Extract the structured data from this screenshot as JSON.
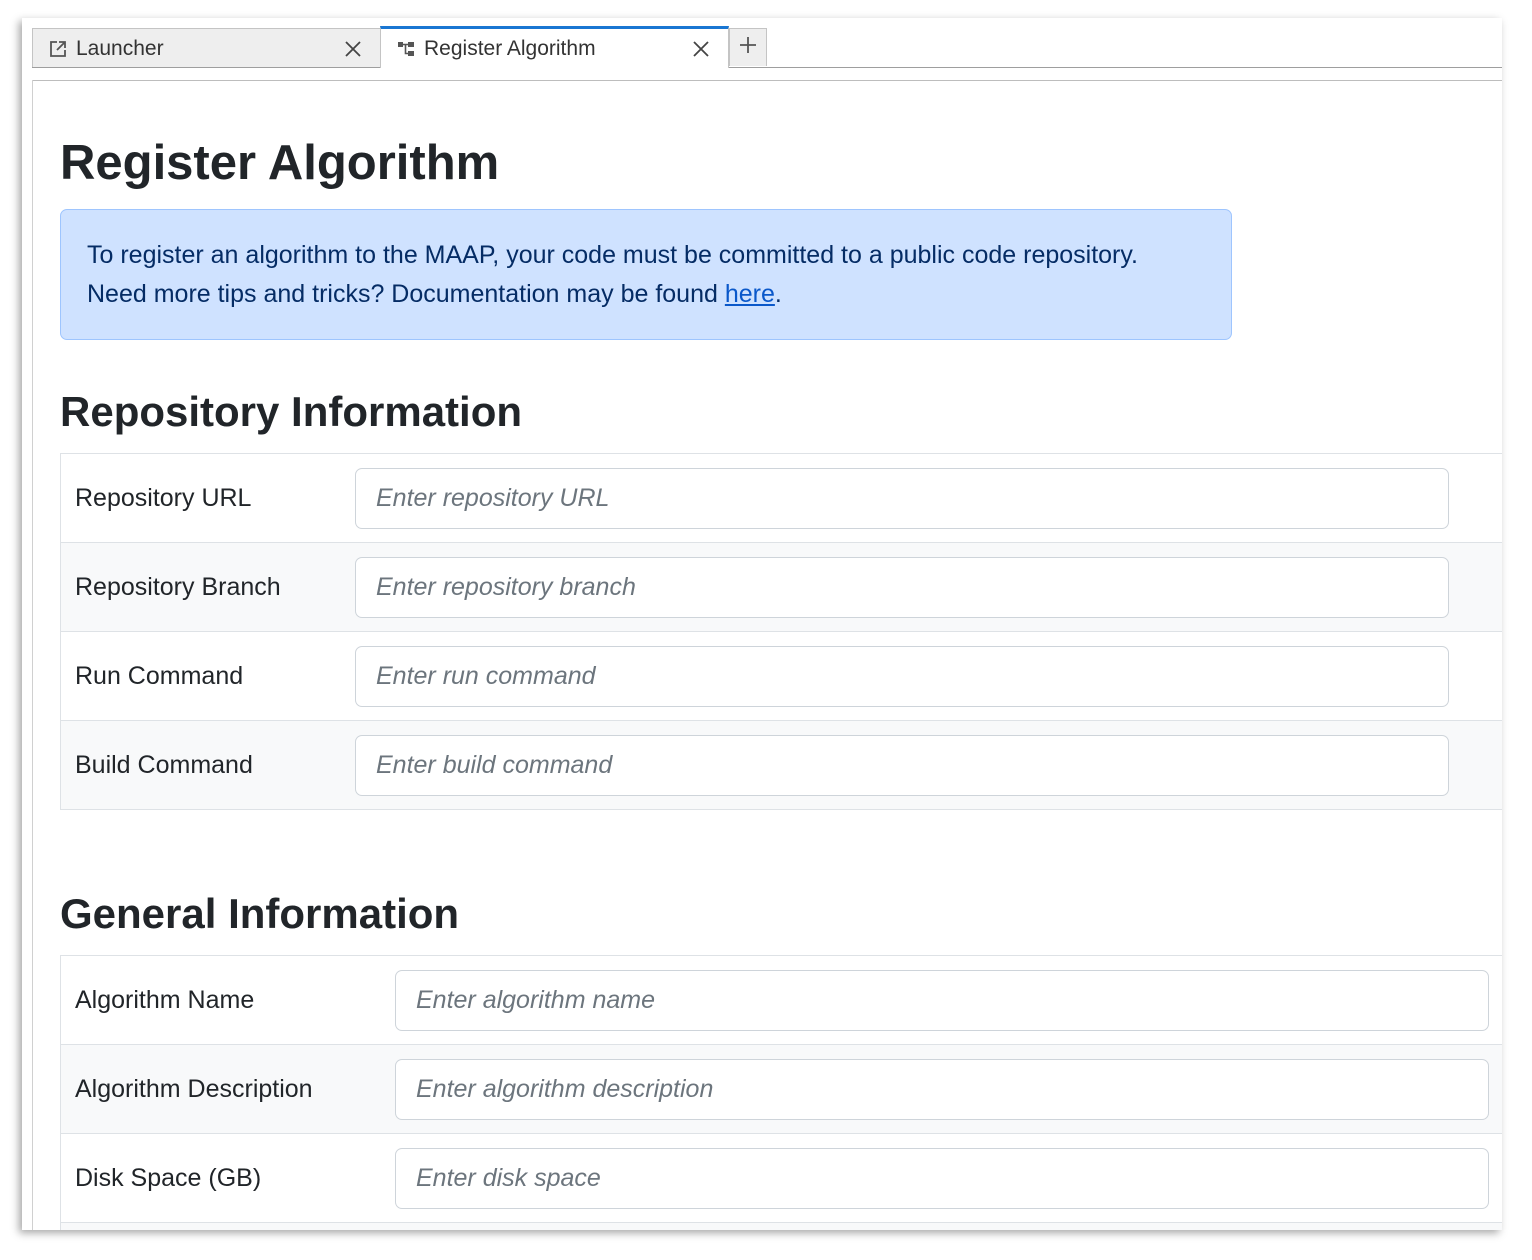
{
  "tabs": [
    {
      "label": "Launcher",
      "icon": "launch-icon",
      "active": false
    },
    {
      "label": "Register Algorithm",
      "icon": "algorithm-tree-icon",
      "active": true
    }
  ],
  "new_tab_icon": "plus-icon",
  "page": {
    "title": "Register Algorithm",
    "alert": {
      "line1": "To register an algorithm to the MAAP, your code must be committed to a public code repository.",
      "line2_prefix": "Need more tips and tricks? Documentation may be found ",
      "link_text": "here",
      "line2_suffix": "."
    }
  },
  "repository": {
    "title": "Repository Information",
    "fields": [
      {
        "label": "Repository URL",
        "placeholder": "Enter repository URL",
        "value": ""
      },
      {
        "label": "Repository Branch",
        "placeholder": "Enter repository branch",
        "value": ""
      },
      {
        "label": "Run Command",
        "placeholder": "Enter run command",
        "value": ""
      },
      {
        "label": "Build Command",
        "placeholder": "Enter build command",
        "value": ""
      }
    ]
  },
  "general": {
    "title": "General Information",
    "fields": [
      {
        "label": "Algorithm Name",
        "placeholder": "Enter algorithm name",
        "value": ""
      },
      {
        "label": "Algorithm Description",
        "placeholder": "Enter algorithm description",
        "value": ""
      },
      {
        "label": "Disk Space (GB)",
        "placeholder": "Enter disk space",
        "value": ""
      }
    ]
  },
  "colors": {
    "alert_bg": "#cfe2ff",
    "alert_border": "#9ec5fe",
    "alert_text": "#052c65",
    "link": "#0a58ca",
    "active_tab_accent": "#1976d2"
  }
}
